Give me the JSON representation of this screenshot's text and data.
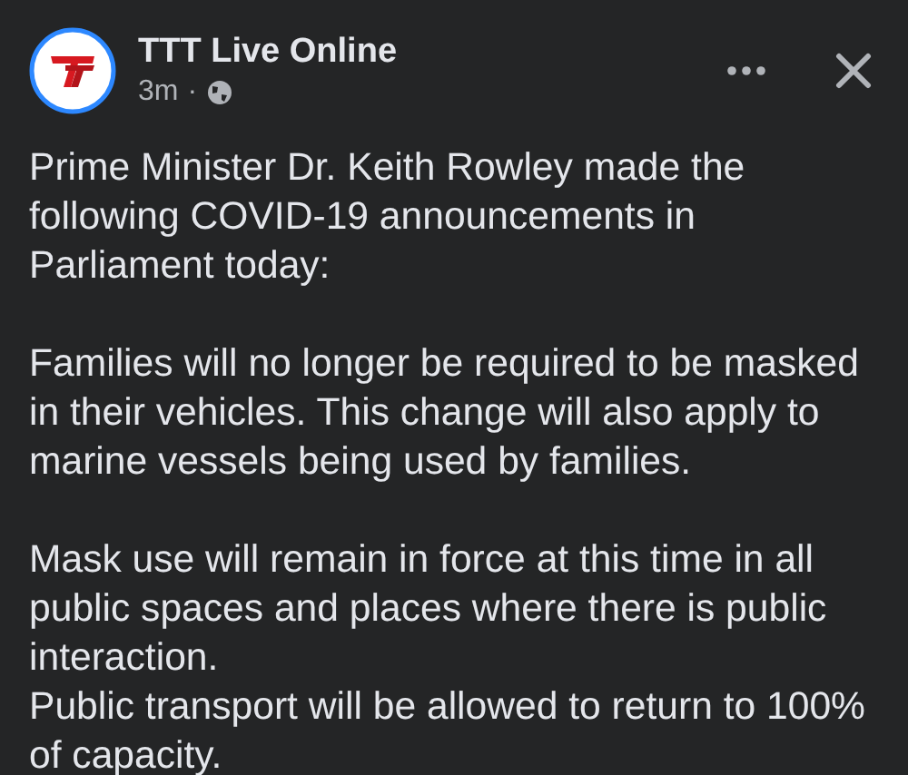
{
  "post": {
    "author": "TTT Live Online",
    "time": "3m",
    "separator": "·",
    "blocks": [
      {
        "paragraphs": [
          {
            "lines": [
              "Prime Minister Dr. Keith Rowley made the",
              "following COVID-19 announcements in",
              "Parliament today:"
            ]
          }
        ]
      },
      {
        "paragraphs": [
          {
            "lines": [
              "Families will no longer be required to be masked",
              "in their vehicles. This change will also apply to",
              "marine vessels being used by families."
            ]
          }
        ]
      },
      {
        "paragraphs": [
          {
            "lines": [
              "Mask use will remain in force at this time in all",
              "public spaces and places where there is public",
              "interaction."
            ]
          },
          {
            "lines": [
              "Public transport will be allowed to return to 100%",
              "of capacity."
            ]
          }
        ]
      }
    ]
  }
}
